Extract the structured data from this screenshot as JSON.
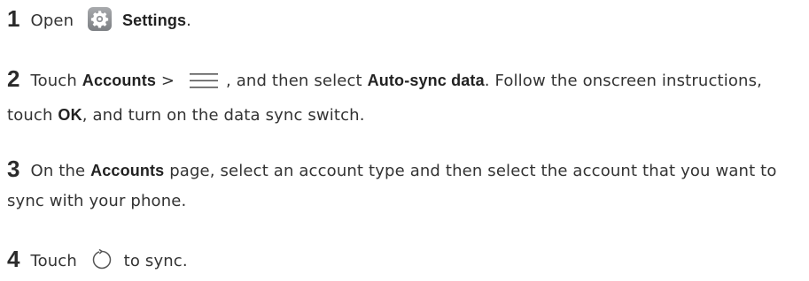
{
  "steps": [
    {
      "number": "1",
      "open": "Open",
      "settings": "Settings",
      "period": ".",
      "icon": "settings-gear-icon"
    },
    {
      "number": "2",
      "touch": "Touch",
      "accounts": "Accounts",
      "gt": ">",
      "then_select": ", and then select",
      "auto_sync": "Auto-sync data",
      "follow": ". Follow the onscreen instructions, touch",
      "ok": "OK",
      "turn_on": ", and turn on the data sync switch.",
      "icon": "menu-icon"
    },
    {
      "number": "3",
      "on_the": "On the",
      "accounts": "Accounts",
      "rest": "page, select an account type and then select the account that you want to sync with your phone."
    },
    {
      "number": "4",
      "touch": "Touch",
      "to_sync": "to sync.",
      "icon": "sync-icon"
    }
  ],
  "colors": {
    "text": "#333333",
    "icon_bg": "#8e9094"
  }
}
